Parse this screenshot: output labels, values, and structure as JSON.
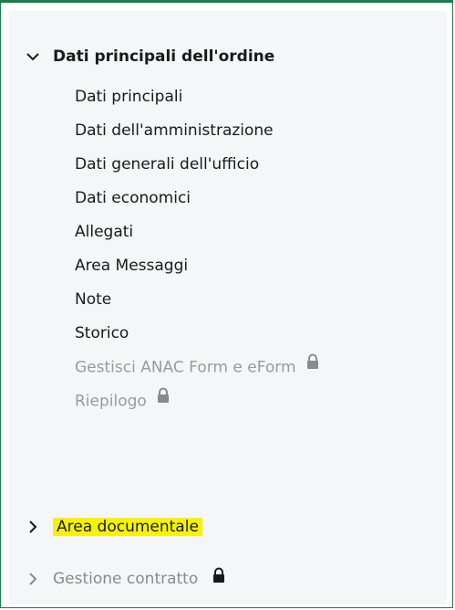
{
  "menu": {
    "section_main": {
      "label": "Dati principali dell'ordine"
    },
    "items": [
      {
        "label": "Dati principali",
        "disabled": false
      },
      {
        "label": "Dati dell'amministrazione",
        "disabled": false
      },
      {
        "label": "Dati generali dell'ufficio",
        "disabled": false
      },
      {
        "label": "Dati economici",
        "disabled": false
      },
      {
        "label": "Allegati",
        "disabled": false
      },
      {
        "label": "Area Messaggi",
        "disabled": false
      },
      {
        "label": "Note",
        "disabled": false
      },
      {
        "label": "Storico",
        "disabled": false
      },
      {
        "label": "Gestisci ANAC Form e eForm",
        "disabled": true,
        "icon": "lock-icon"
      },
      {
        "label": "Riepilogo",
        "disabled": true,
        "icon": "lock-icon"
      }
    ],
    "section_docs": {
      "label": "Area documentale"
    },
    "section_contract": {
      "label": "Gestione contratto",
      "icon": "lock-icon"
    }
  },
  "colors": {
    "accent_border": "#1f7a4c",
    "highlight": "#f7f300",
    "disabled_text": "#9a9a9a"
  }
}
